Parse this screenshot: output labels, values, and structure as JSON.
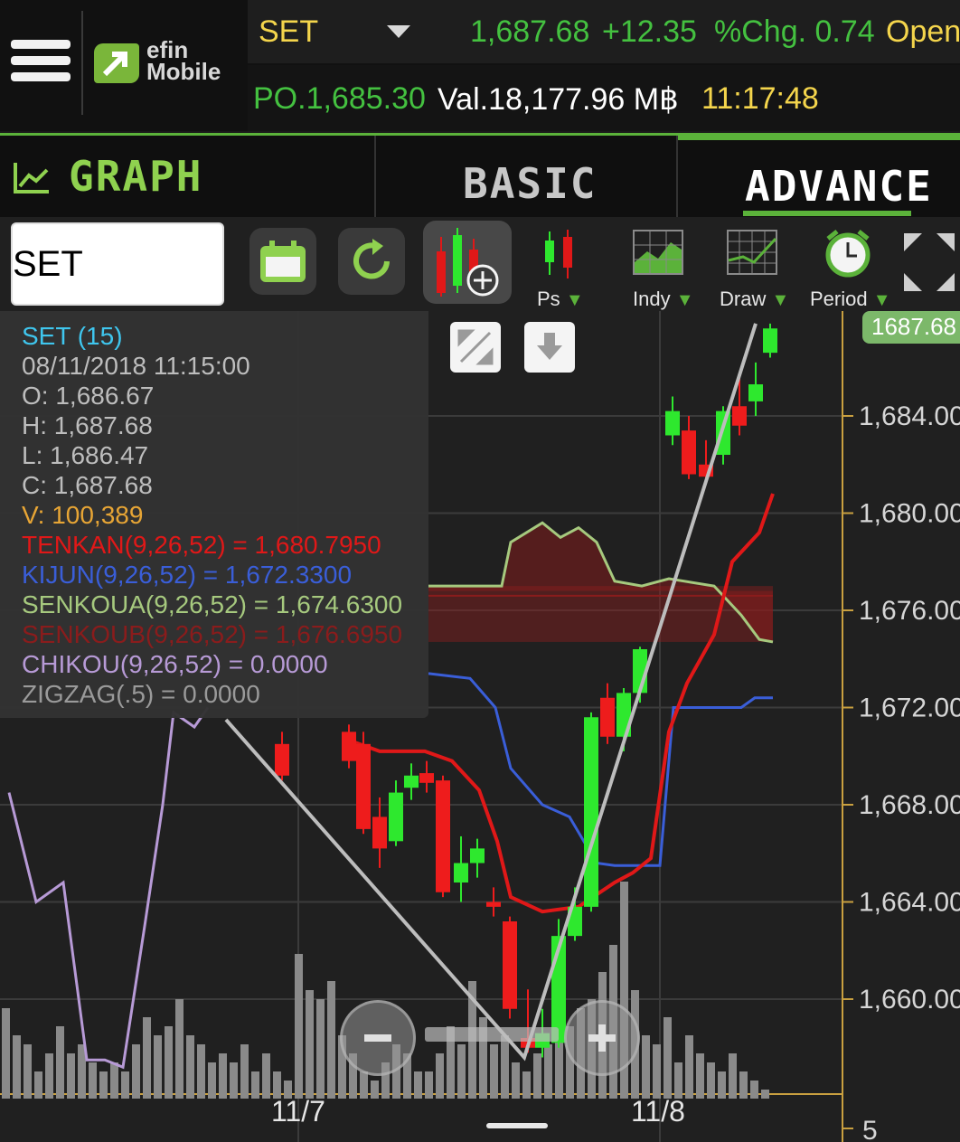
{
  "header": {
    "menu_icon": "hamburger-menu-icon",
    "logo_line1": "efin",
    "logo_line2": "Mobile",
    "symbol": "SET",
    "last": "1,687.68",
    "change": "+12.35",
    "pct_change": "%Chg. 0.74",
    "open_label": "Open",
    "po": "PO.1,685.30",
    "value": "Val.18,177.96 M฿",
    "time": "11:17:48"
  },
  "tabs": {
    "graph": "GRAPH",
    "basic": "BASIC",
    "advance": "ADVANCE",
    "active": "ADVANCE"
  },
  "toolbar": {
    "symbol_value": "SET",
    "calendar_icon": "calendar-icon",
    "refresh_icon": "refresh-icon",
    "add_chart_icon": "add-candlestick-icon",
    "ps_label": "Ps",
    "indy_label": "Indy",
    "draw_label": "Draw",
    "period_label": "Period",
    "expand_icon": "expand-arrows-icon"
  },
  "info": {
    "title": "SET (15)",
    "datetime": "08/11/2018 11:15:00",
    "open": "O: 1,686.67",
    "high": "H: 1,687.68",
    "low": "L: 1,686.47",
    "close": "C: 1,687.68",
    "volume": "V: 100,389",
    "tenkan": "TENKAN(9,26,52) = 1,680.7950",
    "kijun": "KIJUN(9,26,52) = 1,672.3300",
    "senkoua": "SENKOUA(9,26,52) = 1,674.6300",
    "senkoub": "SENKOUB(9,26,52) = 1,676.6950",
    "chikou": "CHIKOU(9,26,52) = 0.0000",
    "zigzag": "ZIGZAG(.5) = 0.0000"
  },
  "chart_data": {
    "type": "candlestick",
    "last_price_label": "1687.68",
    "y_ticks": [
      "1,684.00",
      "1,680.00",
      "1,676.00",
      "1,672.00",
      "1,668.00",
      "1,664.00",
      "1,660.00"
    ],
    "volume_tick": "5",
    "x_labels": [
      "11/7",
      "11/8"
    ],
    "colors": {
      "up": "#2ee82e",
      "down": "#ee1c1c",
      "tenkan": "#e01818",
      "kijun": "#3a5ed8",
      "senkou_a": "#a6c97e",
      "senkou_b": "#8a1c1c",
      "chikou": "#b79ad6",
      "zigzag": "#bdbdbd"
    }
  }
}
